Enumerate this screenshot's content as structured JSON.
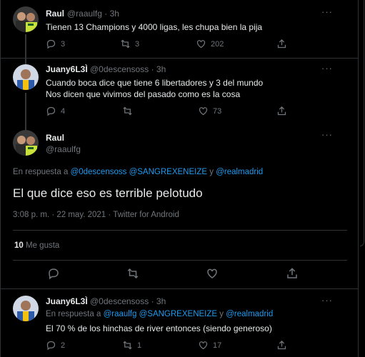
{
  "tweets": [
    {
      "name": "Raul",
      "handle": "@raaulfg",
      "time": "3h",
      "text": [
        "Tienen 13 Champions y 4000 ligas, les chupa bien la pija"
      ],
      "replies": "3",
      "retweets": "3",
      "likes": "202"
    },
    {
      "name": "Juany6L3Ì",
      "handle": "@0descensoss",
      "time": "3h",
      "text": [
        "Cuando boca dice que tiene 6 libertadores y 3 del mundo",
        "Nos dicen que vivimos del pasado como es la cosa"
      ],
      "replies": "4",
      "retweets": "",
      "likes": "73"
    }
  ],
  "main_tweet": {
    "name": "Raul",
    "handle": "@raaulfg",
    "reply_prefix": "En respuesta a",
    "mention1": "@0descensoss",
    "mention2": "@SANGREXENEIZE",
    "and_word": "y",
    "mention3": "@realmadrid",
    "text": "El que dice eso es terrible pelotudo",
    "meta": "3:08 p. m. · 22 may. 2021 · Twitter for Android",
    "likes_count": "10",
    "likes_label": "Me gusta"
  },
  "reply_tweet": {
    "name": "Juany6L3Ì",
    "handle": "@0descensoss",
    "time": "3h",
    "reply_prefix": "En respuesta a",
    "mention1": "@raaulfg",
    "mention2": "@SANGREXENEIZE",
    "and_word": "y",
    "mention3": "@realmadrid",
    "text": "El 70 % de los hinchas de river entonces (siendo generoso)",
    "replies": "2",
    "retweets": "1",
    "likes": "17"
  },
  "sep": "·",
  "more_glyph": "···",
  "icons": [
    "reply-icon",
    "retweet-icon",
    "like-icon",
    "share-icon",
    "more-icon"
  ],
  "colors": {
    "background": "#000000",
    "link": "#1d9bf0",
    "muted": "#71767b",
    "text": "#e7e9ea",
    "border": "#2f3336"
  }
}
